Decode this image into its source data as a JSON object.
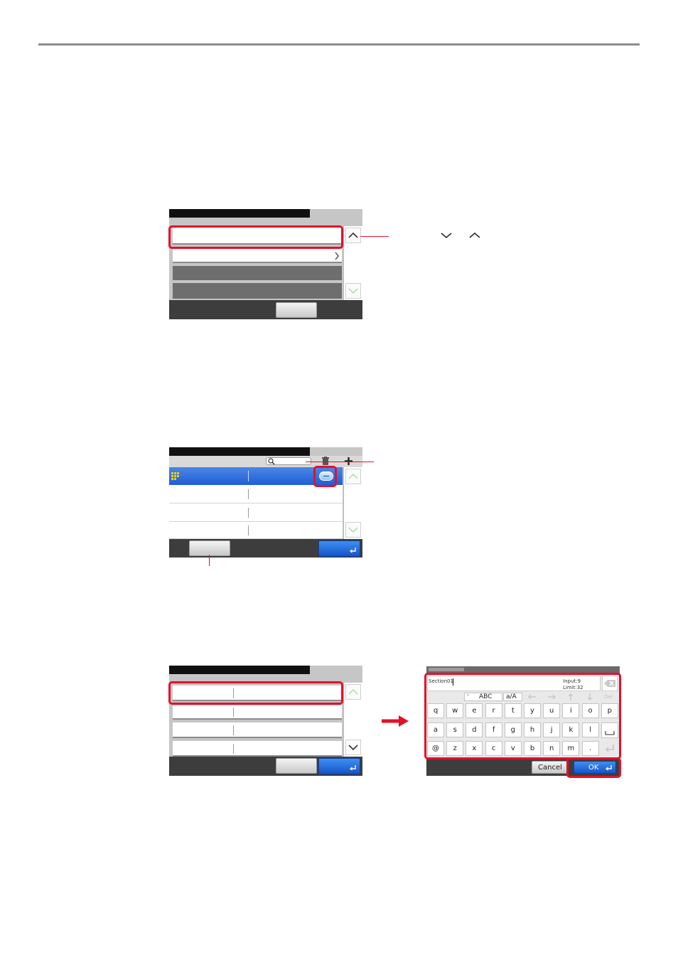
{
  "panel3": {
    "keyboard": {
      "input_text": "Section01",
      "input_count": "Input:9",
      "input_limit": "Limit:32",
      "mode_label": "ABC",
      "case_label": "a/A",
      "del_label": "Del",
      "cancel_label": "Cancel",
      "ok_label": "OK",
      "row1": [
        "q",
        "w",
        "e",
        "r",
        "t",
        "y",
        "u",
        "i",
        "o",
        "p"
      ],
      "row2": [
        "a",
        "s",
        "d",
        "f",
        "g",
        "h",
        "j",
        "k",
        "l"
      ],
      "row3": [
        "@",
        "z",
        "x",
        "c",
        "v",
        "b",
        "n",
        "m",
        "."
      ]
    }
  },
  "icons": {
    "panel1_up": "chevron-up-icon",
    "panel1_down": "chevron-down-icon",
    "search": "search-icon",
    "delete": "trash-icon",
    "add": "plus-icon",
    "enter": "enter-icon",
    "arrow": "right-arrow-icon"
  },
  "colors": {
    "highlight": "#e4102a",
    "selected_row": "#1f5fd6",
    "button_blue": "#1654c9",
    "title_bar": "#111111",
    "bottom_bar": "#3d3d3d"
  }
}
